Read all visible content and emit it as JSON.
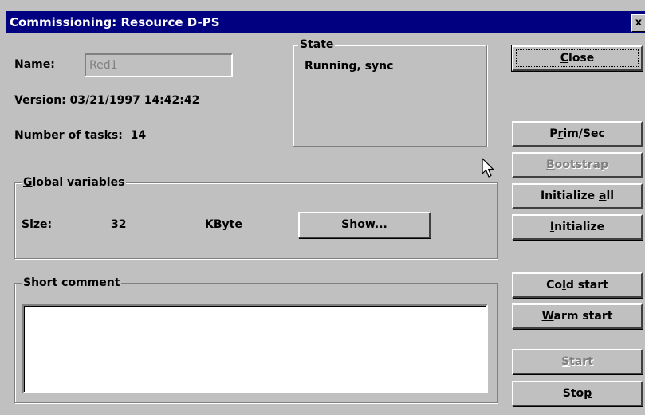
{
  "window": {
    "title": "Commissioning: Resource D-PS",
    "close_glyph": "x"
  },
  "name": {
    "label": "Name:",
    "value": "Red1"
  },
  "version": {
    "label": "Version:",
    "value": "03/21/1997 14:42:42"
  },
  "tasks": {
    "label": "Number of tasks:",
    "value": "14"
  },
  "state": {
    "label": "State",
    "value": "Running, sync"
  },
  "global_vars": {
    "label_prefix": "G",
    "label_rest": "lobal variables",
    "size_label": "Size:",
    "size_value": "32",
    "size_unit": "KByte",
    "show_button": {
      "pre": "Sh",
      "u": "o",
      "post": "w..."
    }
  },
  "comment": {
    "label": "Short comment",
    "value": ""
  },
  "buttons": {
    "close": {
      "u": "C",
      "post": "lose"
    },
    "prim_sec": {
      "pre": "P",
      "u": "r",
      "post": "im/Sec"
    },
    "bootstrap": {
      "u": "B",
      "post": "ootstrap"
    },
    "init_all": {
      "pre": "Initialize ",
      "u": "a",
      "post": "ll"
    },
    "initialize": {
      "u": "I",
      "post": "nitialize"
    },
    "cold_start": {
      "pre": "Co",
      "u": "l",
      "post": "d start"
    },
    "warm_start": {
      "u": "W",
      "post": "arm start"
    },
    "start": {
      "u": "S",
      "post": "tart"
    },
    "stop": {
      "pre": "Sto",
      "u": "p",
      "post": ""
    }
  },
  "icons": {
    "cursor": "arrow-cursor-icon"
  }
}
